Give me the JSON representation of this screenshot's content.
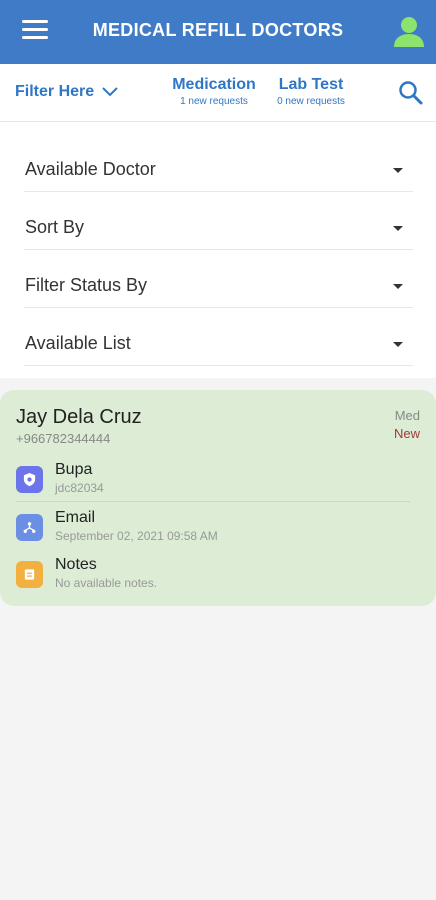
{
  "appbar": {
    "title": "MEDICAL REFILL DOCTORS"
  },
  "subbar": {
    "filter_label": "Filter Here",
    "tabs": [
      {
        "label": "Medication",
        "sub": "1 new requests"
      },
      {
        "label": "Lab Test",
        "sub": "0 new requests"
      }
    ]
  },
  "filters": [
    {
      "label": "Available Doctor"
    },
    {
      "label": "Sort By"
    },
    {
      "label": "Filter Status By"
    },
    {
      "label": "Available List"
    }
  ],
  "card": {
    "name": "Jay Dela Cruz",
    "phone": "+966782344444",
    "type": "Med",
    "status": "New",
    "rows": [
      {
        "title": "Bupa",
        "sub": "jdc82034",
        "icon": "shield-icon"
      },
      {
        "title": "Email",
        "sub": "September 02, 2021 09:58 AM",
        "icon": "share-icon"
      },
      {
        "title": "Notes",
        "sub": "No available notes.",
        "icon": "note-icon"
      }
    ]
  },
  "colors": {
    "primary": "#3f7bc7",
    "accent": "#2f77c4",
    "card_bg": "#dcecd5",
    "status_new": "#a33a3a"
  }
}
